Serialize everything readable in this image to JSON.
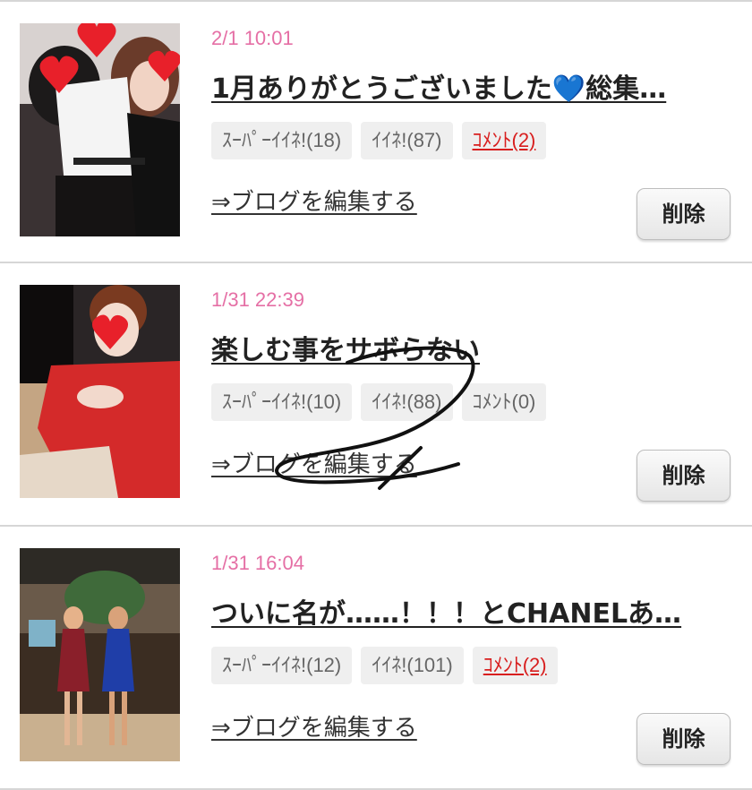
{
  "posts": [
    {
      "date": "2/1 10:01",
      "title": "1月ありがとうございました💙総集…",
      "super_like": "ｽｰﾊﾟｰｲｲﾈ!(18)",
      "like": "ｲｲﾈ!(87)",
      "comment": "ｺﾒﾝﾄ(2)",
      "edit_link": "⇒ブログを編集する",
      "delete_label": "削除"
    },
    {
      "date": "1/31 22:39",
      "title": "楽しむ事をサボらない",
      "super_like": "ｽｰﾊﾟｰｲｲﾈ!(10)",
      "like": "ｲｲﾈ!(88)",
      "comment": "ｺﾒﾝﾄ(0)",
      "edit_link": "⇒ブログを編集する",
      "delete_label": "削除"
    },
    {
      "date": "1/31 16:04",
      "title": "ついに名が……！！！とCHANELあ…",
      "super_like": "ｽｰﾊﾟｰｲｲﾈ!(12)",
      "like": "ｲｲﾈ!(101)",
      "comment": "ｺﾒﾝﾄ(2)",
      "edit_link": "⇒ブログを編集する",
      "delete_label": "削除"
    }
  ],
  "colors": {
    "date_pink": "#e56fa5",
    "comment_red": "#d81e1e",
    "badge_bg": "#efefef",
    "divider": "#d6d6d6"
  }
}
